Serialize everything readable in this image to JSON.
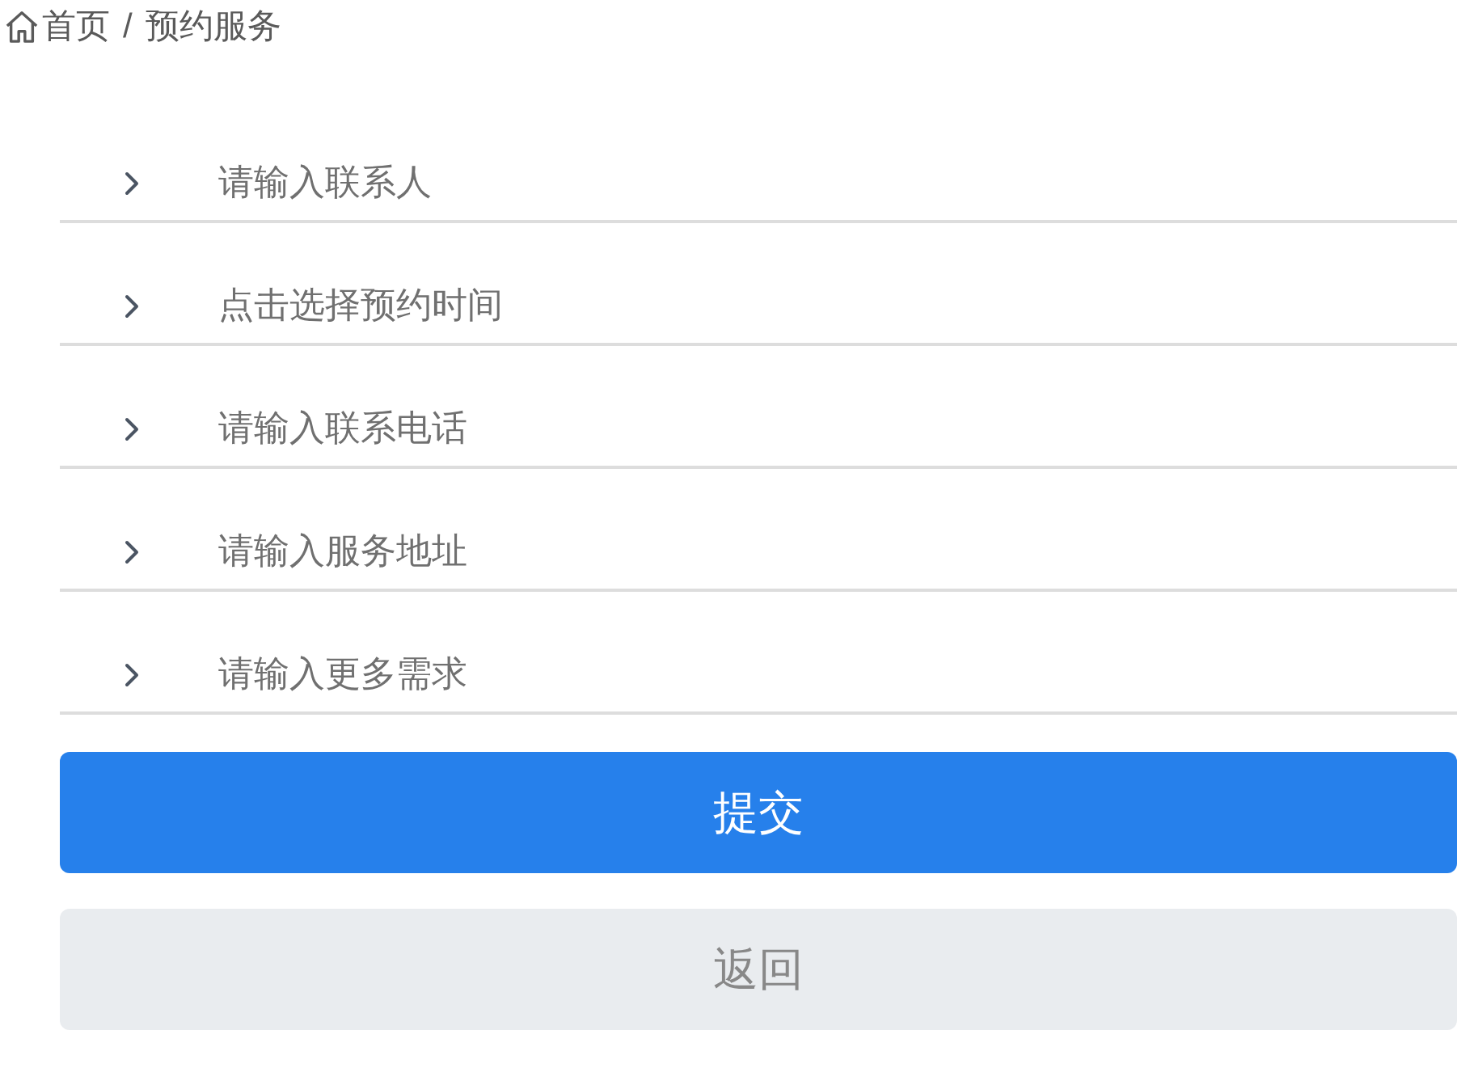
{
  "breadcrumb": {
    "home": "首页",
    "separator": "/",
    "current": "预约服务"
  },
  "form": {
    "fields": [
      {
        "placeholder": "请输入联系人"
      },
      {
        "placeholder": "点击选择预约时间"
      },
      {
        "placeholder": "请输入联系电话"
      },
      {
        "placeholder": "请输入服务地址"
      },
      {
        "placeholder": "请输入更多需求"
      }
    ]
  },
  "buttons": [
    {
      "label": "提交",
      "kind": "primary"
    },
    {
      "label": "返回",
      "kind": "secondary"
    }
  ]
}
